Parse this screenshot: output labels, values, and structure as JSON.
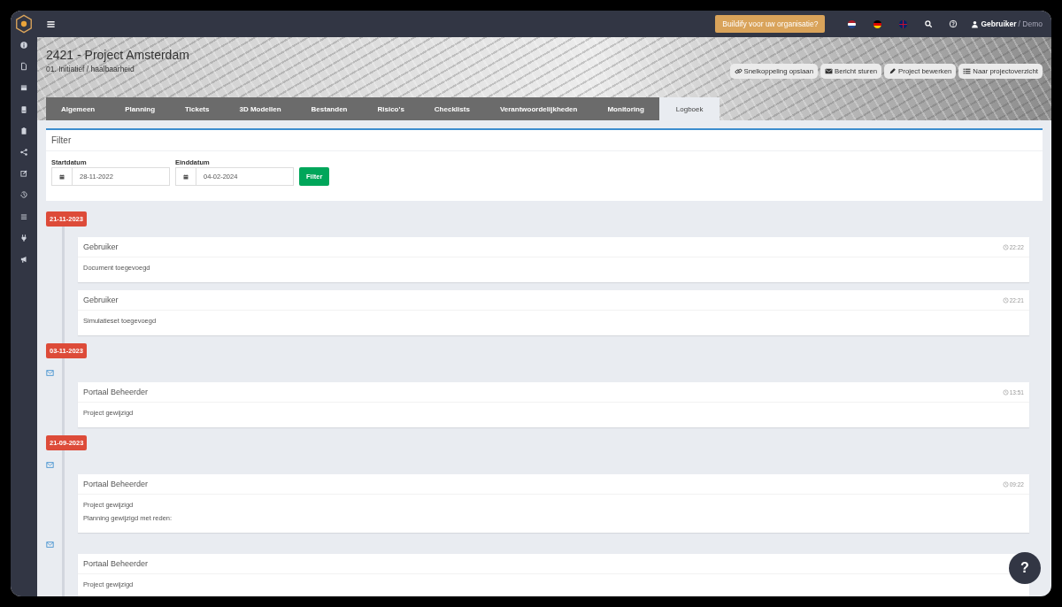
{
  "topbar": {
    "promo_button": "Buildify voor uw organisatie?",
    "languages": [
      {
        "kind": "nl",
        "selected": false
      },
      {
        "kind": "de",
        "selected": false
      },
      {
        "kind": "en",
        "selected": false
      }
    ],
    "user": "Gebruiker",
    "account": "/ Demo"
  },
  "project": {
    "title": "2421 - Project Amsterdam",
    "phase": "01. Initiatief / haalbaarheid"
  },
  "actions": [
    {
      "kind": "link",
      "label": "Snelkoppeling opslaan"
    },
    {
      "kind": "mail",
      "label": "Bericht sturen"
    },
    {
      "kind": "edit",
      "label": "Project bewerken"
    },
    {
      "kind": "list",
      "label": "Naar projectoverzicht"
    }
  ],
  "tabs": [
    {
      "label": "Algemeen",
      "selected": false
    },
    {
      "label": "Planning",
      "selected": false
    },
    {
      "label": "Tickets",
      "selected": false
    },
    {
      "label": "3D Modellen",
      "selected": false
    },
    {
      "label": "Bestanden",
      "selected": false
    },
    {
      "label": "Risico's",
      "selected": false
    },
    {
      "label": "Checklists",
      "selected": false
    },
    {
      "label": "Verantwoordelijkheden",
      "selected": false
    },
    {
      "label": "Monitoring",
      "selected": false
    },
    {
      "label": "Logboek",
      "selected": true
    }
  ],
  "filter": {
    "title": "Filter",
    "fields": [
      {
        "label": "Startdatum",
        "value": "28-11-2022"
      },
      {
        "label": "Einddatum",
        "value": "04-02-2024"
      }
    ],
    "button": "Filter"
  },
  "timeline": [
    {
      "date": "21-11-2023",
      "entries": [
        {
          "mail": false,
          "author": "Gebruiker",
          "time": "22:22",
          "lines": [
            "Document toegevoegd"
          ]
        },
        {
          "mail": false,
          "author": "Gebruiker",
          "time": "22:21",
          "lines": [
            "Simulatieset toegevoegd"
          ]
        }
      ]
    },
    {
      "date": "03-11-2023",
      "entries": [
        {
          "mail": true,
          "author": "Portaal Beheerder",
          "time": "13:51",
          "lines": [
            "Project gewijzigd"
          ]
        }
      ]
    },
    {
      "date": "21-09-2023",
      "entries": [
        {
          "mail": true,
          "author": "Portaal Beheerder",
          "time": "09:22",
          "lines": [
            "Project gewijzigd",
            "Planning gewijzigd met reden:"
          ]
        },
        {
          "mail": true,
          "author": "Portaal Beheerder",
          "lines": [
            "Project gewijzigd"
          ]
        }
      ]
    }
  ],
  "help_button": "?"
}
